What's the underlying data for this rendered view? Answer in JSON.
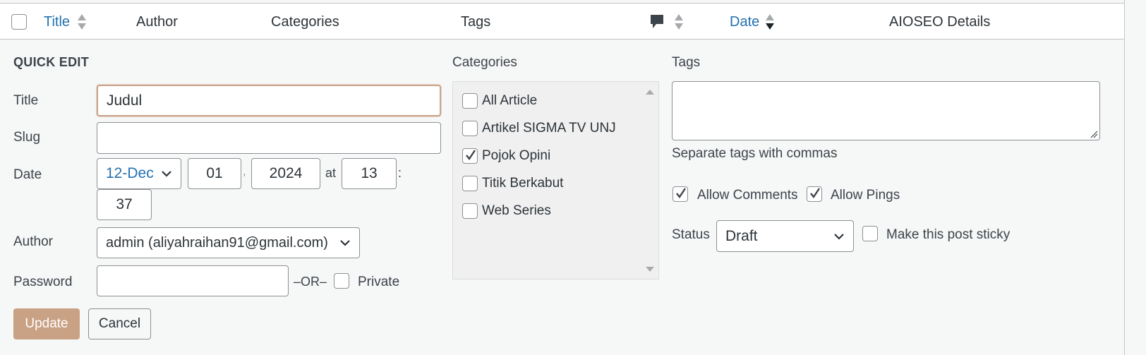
{
  "table_header": {
    "title": "Title",
    "author": "Author",
    "categories": "Categories",
    "tags": "Tags",
    "date": "Date",
    "aioseo": "AIOSEO Details"
  },
  "quick_edit": {
    "heading": "QUICK EDIT",
    "title_label": "Title",
    "title_value": "Judul",
    "slug_label": "Slug",
    "slug_value": "",
    "date_label": "Date",
    "month": "12-Dec",
    "day": "01",
    "comma": ",",
    "year": "2024",
    "at": "at",
    "hour": "13",
    "colon": ":",
    "minute": "37",
    "author_label": "Author",
    "author_value": "admin (aliyahraihan91@gmail.com)",
    "password_label": "Password",
    "password_value": "",
    "or_text": "–OR–",
    "private_label": "Private",
    "update_button": "Update",
    "cancel_button": "Cancel"
  },
  "categories_panel": {
    "heading": "Categories",
    "items": [
      {
        "label": "All Article",
        "checked": false
      },
      {
        "label": "Artikel SIGMA TV UNJ",
        "checked": false
      },
      {
        "label": "Pojok Opini",
        "checked": true
      },
      {
        "label": "Titik Berkabut",
        "checked": false
      },
      {
        "label": "Web Series",
        "checked": false
      }
    ]
  },
  "tags_panel": {
    "heading": "Tags",
    "tags_value": "",
    "hint": "Separate tags with commas",
    "allow_comments_label": "Allow Comments",
    "allow_comments_checked": true,
    "allow_pings_label": "Allow Pings",
    "allow_pings_checked": true,
    "status_label": "Status",
    "status_value": "Draft",
    "sticky_label": "Make this post sticky",
    "sticky_checked": false
  },
  "colors": {
    "link": "#2271b1",
    "update_button_bg": "#c9a184",
    "focus_border": "#c8a48e",
    "panel_bg": "#f6f7f7"
  }
}
